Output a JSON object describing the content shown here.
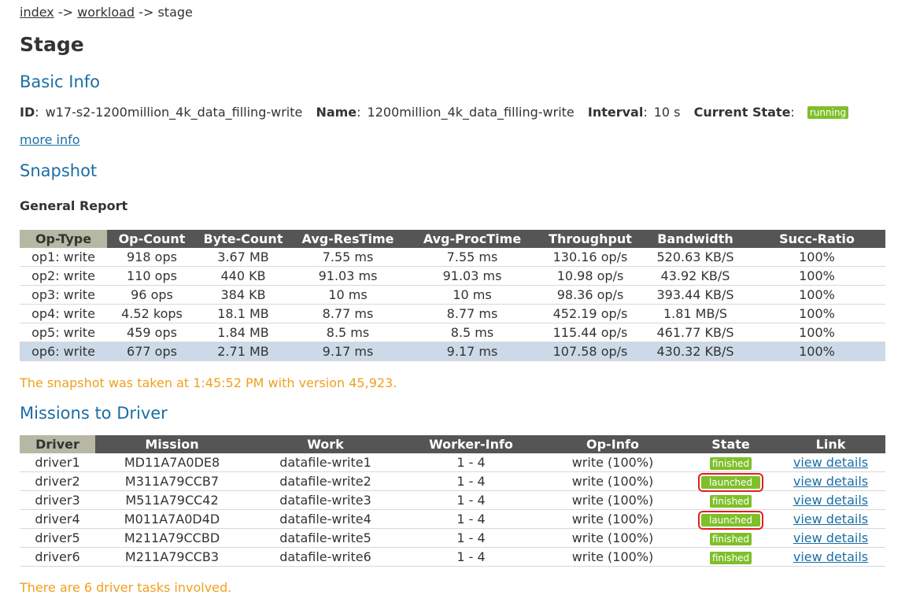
{
  "breadcrumb": {
    "index": "index",
    "sep1": "->",
    "workload": "workload",
    "sep2": "->",
    "stage": "stage"
  },
  "page_title": "Stage",
  "basic_info": {
    "heading": "Basic Info",
    "id_label": "ID",
    "id_value": "w17-s2-1200million_4k_data_filling-write",
    "name_label": "Name",
    "name_value": "1200million_4k_data_filling-write",
    "interval_label": "Interval",
    "interval_value": "10 s",
    "state_label": "Current State",
    "state_value": "running",
    "more_info": "more info"
  },
  "snapshot": {
    "heading": "Snapshot",
    "subheading": "General Report",
    "columns": [
      "Op-Type",
      "Op-Count",
      "Byte-Count",
      "Avg-ResTime",
      "Avg-ProcTime",
      "Throughput",
      "Bandwidth",
      "Succ-Ratio"
    ],
    "rows": [
      [
        "op1: write",
        "918 ops",
        "3.67 MB",
        "7.55 ms",
        "7.55 ms",
        "130.16 op/s",
        "520.63 KB/S",
        "100%"
      ],
      [
        "op2: write",
        "110 ops",
        "440 KB",
        "91.03 ms",
        "91.03 ms",
        "10.98 op/s",
        "43.92 KB/S",
        "100%"
      ],
      [
        "op3: write",
        "96 ops",
        "384 KB",
        "10 ms",
        "10 ms",
        "98.36 op/s",
        "393.44 KB/S",
        "100%"
      ],
      [
        "op4: write",
        "4.52 kops",
        "18.1 MB",
        "8.77 ms",
        "8.77 ms",
        "452.19 op/s",
        "1.81 MB/S",
        "100%"
      ],
      [
        "op5: write",
        "459 ops",
        "1.84 MB",
        "8.5 ms",
        "8.5 ms",
        "115.44 op/s",
        "461.77 KB/S",
        "100%"
      ],
      [
        "op6: write",
        "677 ops",
        "2.71 MB",
        "9.17 ms",
        "9.17 ms",
        "107.58 op/s",
        "430.32 KB/S",
        "100%"
      ]
    ],
    "note": "The snapshot was taken at 1:45:52 PM with version 45,923."
  },
  "missions": {
    "heading": "Missions to Driver",
    "columns": [
      "Driver",
      "Mission",
      "Work",
      "Worker-Info",
      "Op-Info",
      "State",
      "Link"
    ],
    "rows": [
      {
        "driver": "driver1",
        "mission": "MD11A7A0DE8",
        "work": "datafile-write1",
        "worker": "1 - 4",
        "op": "write (100%)",
        "state": "finished",
        "link": "view details"
      },
      {
        "driver": "driver2",
        "mission": "M311A79CCB7",
        "work": "datafile-write2",
        "worker": "1 - 4",
        "op": "write (100%)",
        "state": "launched",
        "link": "view details"
      },
      {
        "driver": "driver3",
        "mission": "M511A79CC42",
        "work": "datafile-write3",
        "worker": "1 - 4",
        "op": "write (100%)",
        "state": "finished",
        "link": "view details"
      },
      {
        "driver": "driver4",
        "mission": "M011A7A0D4D",
        "work": "datafile-write4",
        "worker": "1 - 4",
        "op": "write (100%)",
        "state": "launched",
        "link": "view details"
      },
      {
        "driver": "driver5",
        "mission": "M211A79CCBD",
        "work": "datafile-write5",
        "worker": "1 - 4",
        "op": "write (100%)",
        "state": "finished",
        "link": "view details"
      },
      {
        "driver": "driver6",
        "mission": "M211A79CCB3",
        "work": "datafile-write6",
        "worker": "1 - 4",
        "op": "write (100%)",
        "state": "finished",
        "link": "view details"
      }
    ],
    "note": "There are 6 driver tasks involved."
  }
}
